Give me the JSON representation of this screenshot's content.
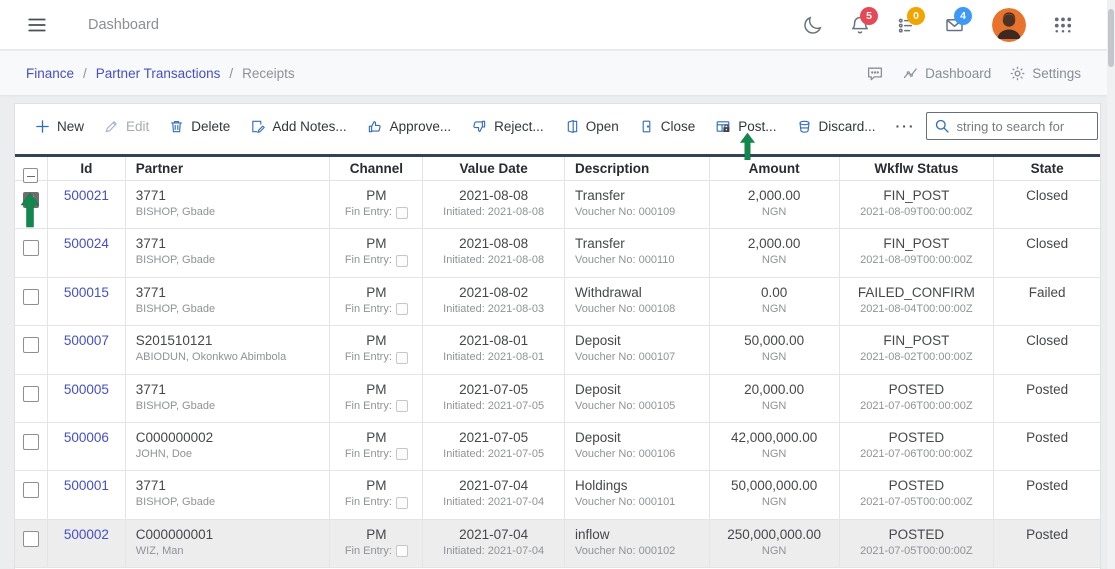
{
  "colors": {
    "accent_blue": "#2f6dbd",
    "link_blue": "#464fc4",
    "table_top_line": "#344258",
    "badge_red": "#e74856",
    "badge_amber": "#f0a500",
    "badge_blue": "#3d99f5",
    "annotation_green": "#12884f"
  },
  "app_bar": {
    "title": "Dashboard",
    "notifications_badge": "5",
    "tasks_badge": "0",
    "messages_badge": "4"
  },
  "breadcrumb": {
    "items": [
      "Finance",
      "Partner Transactions",
      "Receipts"
    ],
    "separator": "/",
    "dashboard_label": "Dashboard",
    "settings_label": "Settings"
  },
  "toolbar": {
    "buttons": [
      {
        "label": "New",
        "disabled": false
      },
      {
        "label": "Edit",
        "disabled": true
      },
      {
        "label": "Delete",
        "disabled": false
      },
      {
        "label": "Add Notes...",
        "disabled": false
      },
      {
        "label": "Approve...",
        "disabled": false
      },
      {
        "label": "Reject...",
        "disabled": false
      },
      {
        "label": "Open",
        "disabled": false
      },
      {
        "label": "Close",
        "disabled": false
      },
      {
        "label": "Post...",
        "disabled": false
      },
      {
        "label": "Discard...",
        "disabled": false
      }
    ],
    "more_label": "···",
    "search_placeholder": "string to search for"
  },
  "table": {
    "columns": [
      "Id",
      "Partner",
      "Channel",
      "Value Date",
      "Description",
      "Amount",
      "Wkflw Status",
      "State"
    ],
    "fin_entry_label": "Fin Entry:",
    "rows": [
      {
        "id": "500021",
        "partner": "3771",
        "partner_sub": "BISHOP, Gbade",
        "channel": "PM",
        "date": "2021-08-08",
        "date_sub": "Initiated: 2021-08-08",
        "desc": "Transfer",
        "desc_sub": "Voucher No: 000109",
        "amount": "2,000.00",
        "currency": "NGN",
        "status": "FIN_POST",
        "status_sub": "2021-08-09T00:00:00Z",
        "state": "Closed",
        "checked": true,
        "highlighted": false
      },
      {
        "id": "500024",
        "partner": "3771",
        "partner_sub": "BISHOP, Gbade",
        "channel": "PM",
        "date": "2021-08-08",
        "date_sub": "Initiated: 2021-08-08",
        "desc": "Transfer",
        "desc_sub": "Voucher No: 000110",
        "amount": "2,000.00",
        "currency": "NGN",
        "status": "FIN_POST",
        "status_sub": "2021-08-09T00:00:00Z",
        "state": "Closed",
        "checked": false,
        "highlighted": false
      },
      {
        "id": "500015",
        "partner": "3771",
        "partner_sub": "BISHOP, Gbade",
        "channel": "PM",
        "date": "2021-08-02",
        "date_sub": "Initiated: 2021-08-03",
        "desc": "Withdrawal",
        "desc_sub": "Voucher No: 000108",
        "amount": "0.00",
        "currency": "NGN",
        "status": "FAILED_CONFIRM",
        "status_sub": "2021-08-04T00:00:00Z",
        "state": "Failed",
        "checked": false,
        "highlighted": false
      },
      {
        "id": "500007",
        "partner": "S201510121",
        "partner_sub": "ABIODUN, Okonkwo Abimbola",
        "channel": "PM",
        "date": "2021-08-01",
        "date_sub": "Initiated: 2021-08-01",
        "desc": "Deposit",
        "desc_sub": "Voucher No: 000107",
        "amount": "50,000.00",
        "currency": "NGN",
        "status": "FIN_POST",
        "status_sub": "2021-08-02T00:00:00Z",
        "state": "Closed",
        "checked": false,
        "highlighted": false
      },
      {
        "id": "500005",
        "partner": "3771",
        "partner_sub": "BISHOP, Gbade",
        "channel": "PM",
        "date": "2021-07-05",
        "date_sub": "Initiated: 2021-07-05",
        "desc": "Deposit",
        "desc_sub": "Voucher No: 000105",
        "amount": "20,000.00",
        "currency": "NGN",
        "status": "POSTED",
        "status_sub": "2021-07-06T00:00:00Z",
        "state": "Posted",
        "checked": false,
        "highlighted": false
      },
      {
        "id": "500006",
        "partner": "C000000002",
        "partner_sub": "JOHN, Doe",
        "channel": "PM",
        "date": "2021-07-05",
        "date_sub": "Initiated: 2021-07-05",
        "desc": "Deposit",
        "desc_sub": "Voucher No: 000106",
        "amount": "42,000,000.00",
        "currency": "NGN",
        "status": "POSTED",
        "status_sub": "2021-07-06T00:00:00Z",
        "state": "Posted",
        "checked": false,
        "highlighted": false
      },
      {
        "id": "500001",
        "partner": "3771",
        "partner_sub": "BISHOP, Gbade",
        "channel": "PM",
        "date": "2021-07-04",
        "date_sub": "Initiated: 2021-07-04",
        "desc": "Holdings",
        "desc_sub": "Voucher No: 000101",
        "amount": "50,000,000.00",
        "currency": "NGN",
        "status": "POSTED",
        "status_sub": "2021-07-05T00:00:00Z",
        "state": "Posted",
        "checked": false,
        "highlighted": false
      },
      {
        "id": "500002",
        "partner": "C000000001",
        "partner_sub": "WIZ, Man",
        "channel": "PM",
        "date": "2021-07-04",
        "date_sub": "Initiated: 2021-07-04",
        "desc": "inflow",
        "desc_sub": "Voucher No: 000102",
        "amount": "250,000,000.00",
        "currency": "NGN",
        "status": "POSTED",
        "status_sub": "2021-07-05T00:00:00Z",
        "state": "Posted",
        "checked": false,
        "highlighted": true
      }
    ]
  }
}
